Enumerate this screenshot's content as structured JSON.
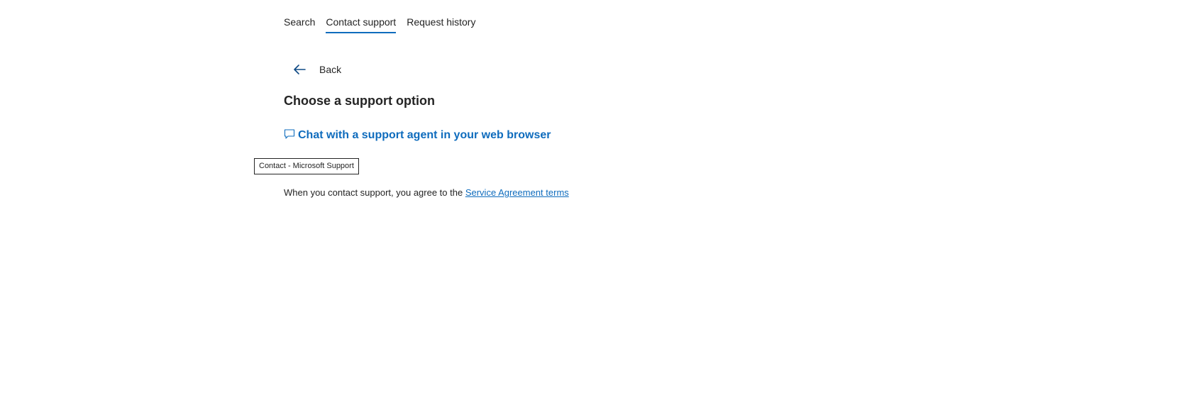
{
  "tabs": [
    {
      "label": "Search",
      "active": false
    },
    {
      "label": "Contact support",
      "active": true
    },
    {
      "label": "Request history",
      "active": false
    }
  ],
  "back": {
    "label": "Back",
    "icon": "arrow-left-icon"
  },
  "main": {
    "heading": "Choose a support option",
    "chat_option": {
      "label": "Chat with a support agent in your web browser",
      "icon": "chat-bubble-icon"
    },
    "tooltip": "Contact - Microsoft Support",
    "agreement_prefix": "When you contact support, you agree to the ",
    "agreement_link": "Service Agreement terms"
  },
  "colors": {
    "accent": "#0f6cbd",
    "text": "#242424"
  }
}
